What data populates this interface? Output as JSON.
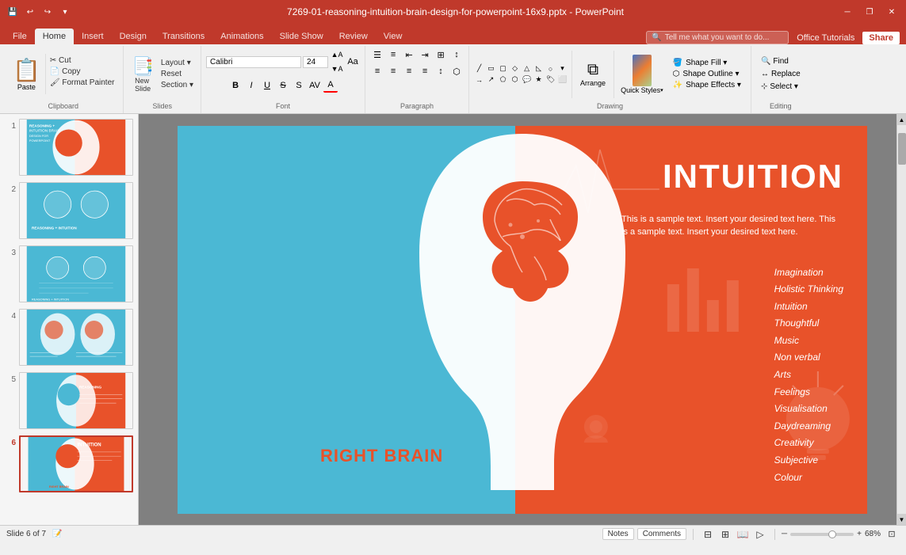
{
  "titlebar": {
    "title": "7269-01-reasoning-intuition-brain-design-for-powerpoint-16x9.pptx - PowerPoint",
    "save_icon": "💾",
    "undo_icon": "↩",
    "redo_icon": "↪",
    "customize_icon": "▾",
    "minimize": "─",
    "restore": "❐",
    "close": "✕"
  },
  "ribbon_tabs": [
    "File",
    "Home",
    "Insert",
    "Design",
    "Transitions",
    "Animations",
    "Slide Show",
    "Review",
    "View"
  ],
  "active_tab": "Home",
  "search_placeholder": "Tell me what you want to do...",
  "office_tutorials": "Office Tutorials",
  "share_label": "Share",
  "groups": {
    "clipboard": "Clipboard",
    "slides": "Slides",
    "font": "Font",
    "paragraph": "Paragraph",
    "drawing": "Drawing",
    "editing": "Editing"
  },
  "ribbon": {
    "paste": "Paste",
    "layout": "Layout ▾",
    "reset": "Reset",
    "section": "Section ▾",
    "new_slide": "New\nSlide",
    "font_name": "Calibri",
    "font_size": "24",
    "bold": "B",
    "italic": "I",
    "underline": "U",
    "strikethrough": "S",
    "arrange": "Arrange",
    "quick_styles": "Quick\nStyles",
    "shape_fill": "Shape Fill ▾",
    "shape_outline": "Shape Outline ▾",
    "shape_effects": "Shape Effects ▾",
    "find": "Find",
    "replace": "Replace",
    "select": "Select ▾"
  },
  "slides": [
    {
      "num": 1,
      "active": false
    },
    {
      "num": 2,
      "active": false
    },
    {
      "num": 3,
      "active": false
    },
    {
      "num": 4,
      "active": false
    },
    {
      "num": 5,
      "active": false
    },
    {
      "num": 6,
      "active": true
    }
  ],
  "slide": {
    "title": "INTUITION",
    "description": "This is a sample text. Insert your desired text here. This is a sample text. Insert your desired text here.",
    "right_brain_label": "RIGHT BRAIN",
    "list_items": [
      "Imagination",
      "Holistic Thinking",
      "Intuition",
      "Thoughtful",
      "Music",
      "Non verbal",
      "Arts",
      "Feelings",
      "Visualisation",
      "Daydreaming",
      "Creativity",
      "Subjective",
      "Colour"
    ]
  },
  "statusbar": {
    "slide_info": "Slide 6 of 7",
    "notes": "Notes",
    "comments": "Comments",
    "zoom": "68%"
  }
}
